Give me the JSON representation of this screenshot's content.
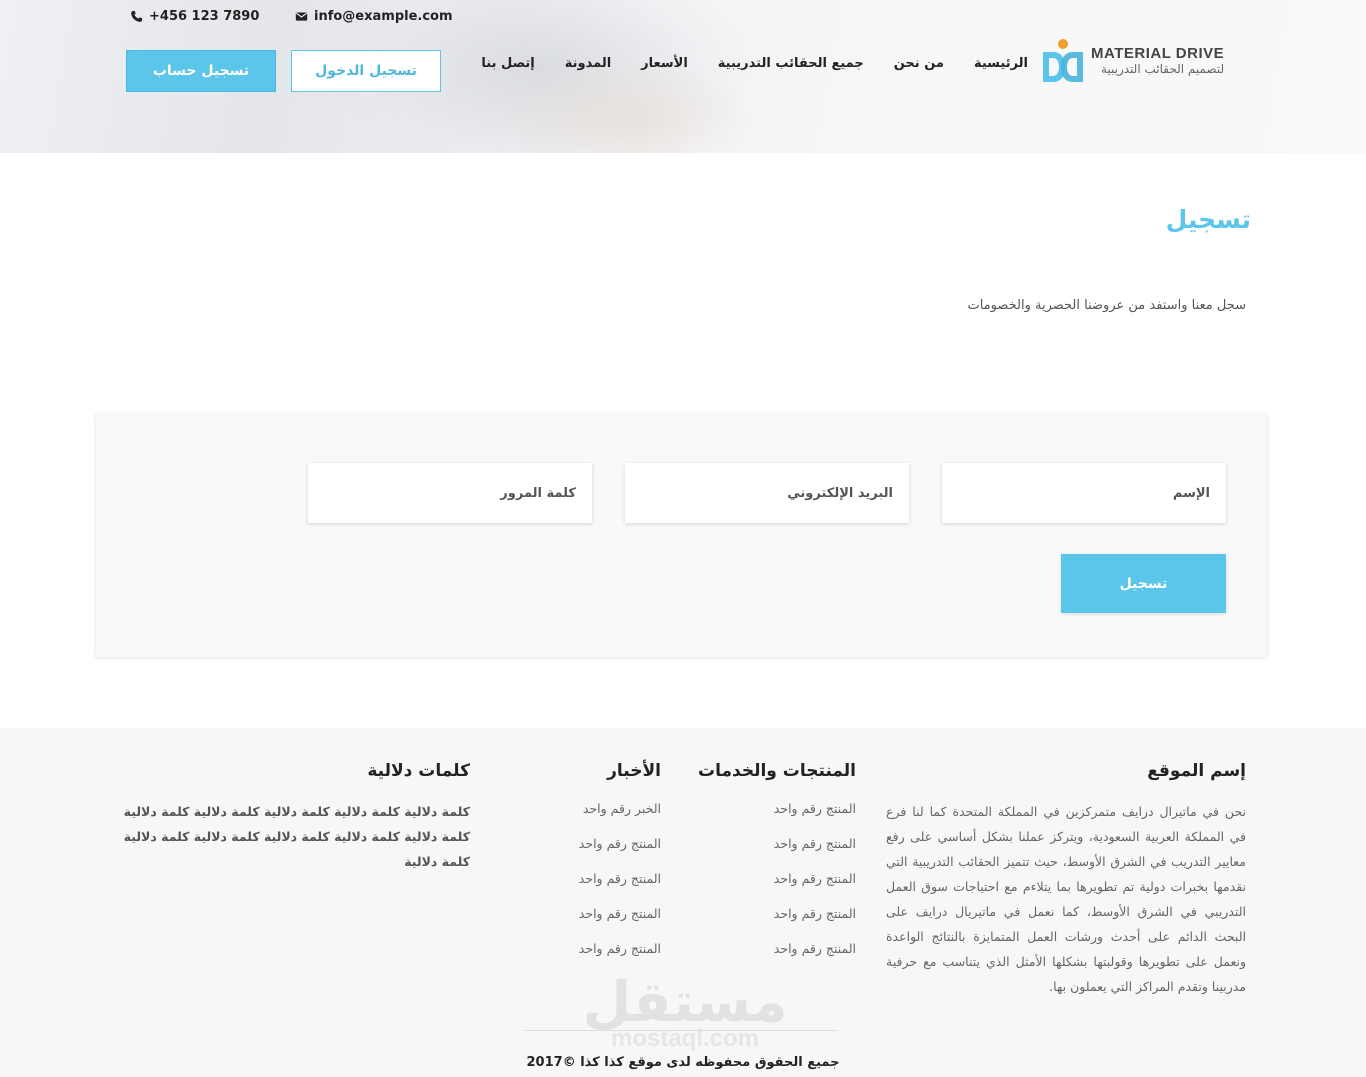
{
  "topbar": {
    "phone": "+456 123 7890",
    "email": "info@example.com"
  },
  "header_buttons": {
    "register": "تسجيل حساب",
    "login": "تسجيل الدخول"
  },
  "nav": {
    "items": [
      "الرئيسية",
      "من نحن",
      "جميع الحقائب التدريبية",
      "الأسعار",
      "المدونة",
      "إتصل بنا"
    ]
  },
  "logo": {
    "title": "MATERIAL DRIVE",
    "subtitle": "لتصميم الحقائب التدريبية"
  },
  "page": {
    "title": "تسجيل",
    "subtitle": "سجل معنا واستفد من عروضنا الحصرية والخصومات"
  },
  "form": {
    "name_placeholder": "الإسم",
    "email_placeholder": "البريد الإلكتروني",
    "password_placeholder": "كلمة المرور",
    "submit_label": "تسجيل"
  },
  "footer": {
    "about": {
      "title": "إسم الموقع",
      "text": "نحن في ماتيرال درايف متمركزين في المملكة المتحدة كما لنا فرع في المملكة العربية السعودية، ويتركز عملنا بشكل أساسي على رفع معايير التدريب في الشرق الأوسط، حيث تتميز الحقائب التدريبية التي نقدمها بخبرات دولية تم تطويرها بما يتلاءم مع احتياجات سوق العمل التدريبي في الشرق الأوسط، كما نعمل في ماتيريال درايف على البحث الدائم على أحدث ورشات العمل المتمايزة بالنتائج الواعدة ونعمل على تطويرها وقولبتها بشكلها الأمثل الذي يتناسب مع حرفية مدربينا وتقدم المراكز التي يعملون بها."
    },
    "products": {
      "title": "المنتجات والخدمات",
      "items": [
        "المنتج رقم واحد",
        "المنتج رقم واحد",
        "المنتج رقم واحد",
        "المنتج رقم واحد",
        "المنتج رقم واحد"
      ]
    },
    "news": {
      "title": "الأخبار",
      "items": [
        "الخبر رقم واحد",
        "المنتج رقم واحد",
        "المنتج رقم واحد",
        "المنتج رقم واحد",
        "المنتج رقم واحد"
      ]
    },
    "tags": {
      "title": "كلمات دلالية",
      "text": "كلمة دلالية كلمة دلالية كلمة دلالية كلمة دلالية كلمة دلالية كلمة دلالية كلمة دلالية كلمة دلالية كلمة دلالية كلمة دلالية كلمة دلالية"
    },
    "watermark": {
      "arabic": "مستقل",
      "latin": "mostaql.com"
    },
    "copyright": "جميع الحقوق محفوظه لدى موقع كذا كذا ©2017"
  },
  "colors": {
    "accent": "#5bc5ea",
    "logo_orange": "#f0a030"
  },
  "icons": {
    "phone": "phone-icon",
    "email": "envelope-icon"
  }
}
